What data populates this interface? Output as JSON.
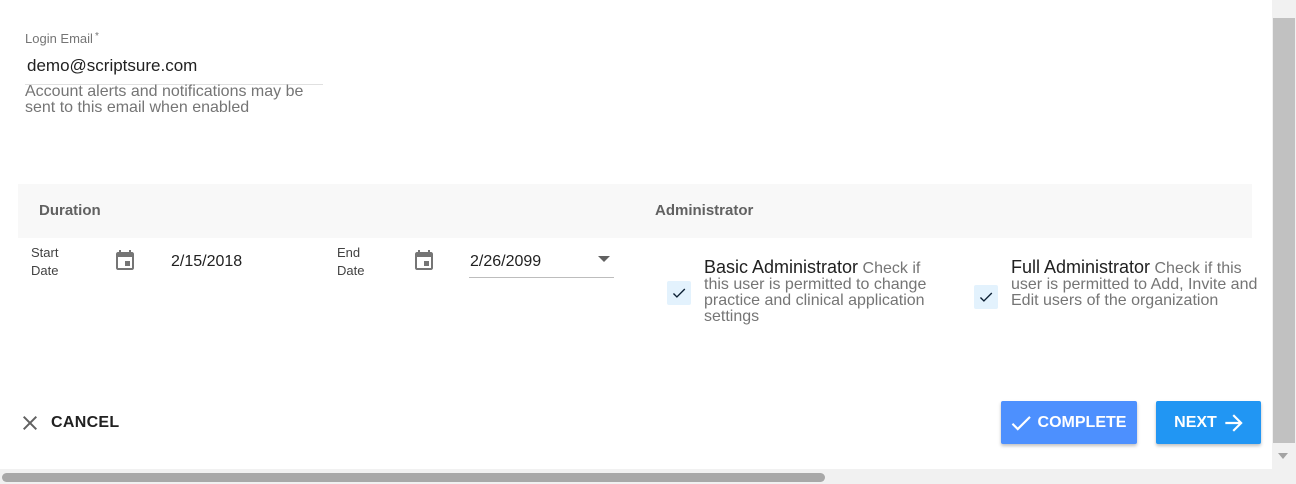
{
  "login": {
    "label": "Login Email",
    "required_mark": "*",
    "value": "demo@scriptsure.com",
    "help": "Account alerts and notifications may be sent to this email when enabled"
  },
  "sections": {
    "duration": "Duration",
    "administrator": "Administrator"
  },
  "start_date": {
    "label_line1": "Start",
    "label_line2": "Date",
    "value": "2/15/2018",
    "icon": "calendar-icon"
  },
  "end_date": {
    "label_line1": "End",
    "label_line2": "Date",
    "value": "2/26/2099",
    "icon": "calendar-icon"
  },
  "admin": {
    "basic": {
      "title": "Basic Administrator",
      "description": "Check if this user is permitted to change practice and clinical application settings",
      "checked": true
    },
    "full": {
      "title": "Full Administrator",
      "description": "Check if this user is permitted to Add, Invite and Edit users of the organization",
      "checked": true
    }
  },
  "actions": {
    "cancel": "CANCEL",
    "complete": "COMPLETE",
    "next": "NEXT"
  },
  "colors": {
    "complete": "#4d90fe",
    "next": "#2196f3",
    "checkbox_bg": "#e3f2fd"
  }
}
